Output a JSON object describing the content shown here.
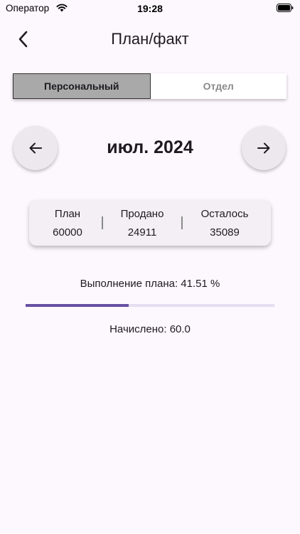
{
  "status_bar": {
    "carrier": "Оператор",
    "time": "19:28",
    "wifi_icon": "wifi-icon",
    "battery_icon": "battery-icon"
  },
  "header": {
    "title": "План/факт",
    "back_icon": "chevron-left-icon"
  },
  "segments": [
    {
      "label": "Персональный",
      "selected": true
    },
    {
      "label": "Отдел",
      "selected": false
    }
  ],
  "period": {
    "label": "июл. 2024",
    "prev_icon": "arrow-left-icon",
    "next_icon": "arrow-right-icon"
  },
  "stats": {
    "plan": {
      "label": "План",
      "value": "60000"
    },
    "sold": {
      "label": "Продано",
      "value": "24911"
    },
    "remaining": {
      "label": "Осталось",
      "value": "35089"
    },
    "separator": "|"
  },
  "progress": {
    "label": "Выполнение плана: 41.51 %",
    "fraction": 0.4151,
    "accent_color": "#6750A4",
    "track_color": "#E6DEF0"
  },
  "accrued": {
    "label": "Начислено: 60.0"
  },
  "colors": {
    "background": "#FDF7FE",
    "card": "#F3EFF5",
    "segment_active": "#A9A9A9"
  }
}
